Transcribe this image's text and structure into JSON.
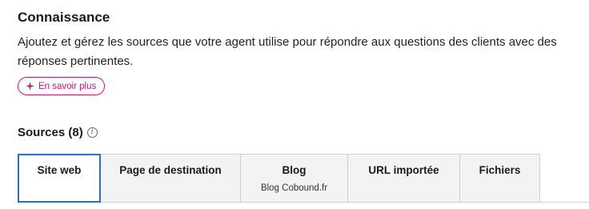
{
  "knowledge": {
    "title": "Connaissance",
    "description": "Ajoutez et gérez les sources que votre agent utilise pour répondre aux questions des clients avec des réponses pertinentes.",
    "learn_more_label": "En savoir plus",
    "learn_more_icon": "sparkle-icon",
    "accent_color": "#c4167a"
  },
  "sources": {
    "title": "Sources (8)",
    "info_icon": "info-icon",
    "tabs": [
      {
        "label": "Site web",
        "sub": "",
        "active": true
      },
      {
        "label": "Page de destination",
        "sub": ""
      },
      {
        "label": "Blog",
        "sub": "Blog Cobound.fr"
      },
      {
        "label": "URL importée",
        "sub": ""
      },
      {
        "label": "Fichiers",
        "sub": ""
      }
    ],
    "active_color": "#2f6fb7"
  }
}
